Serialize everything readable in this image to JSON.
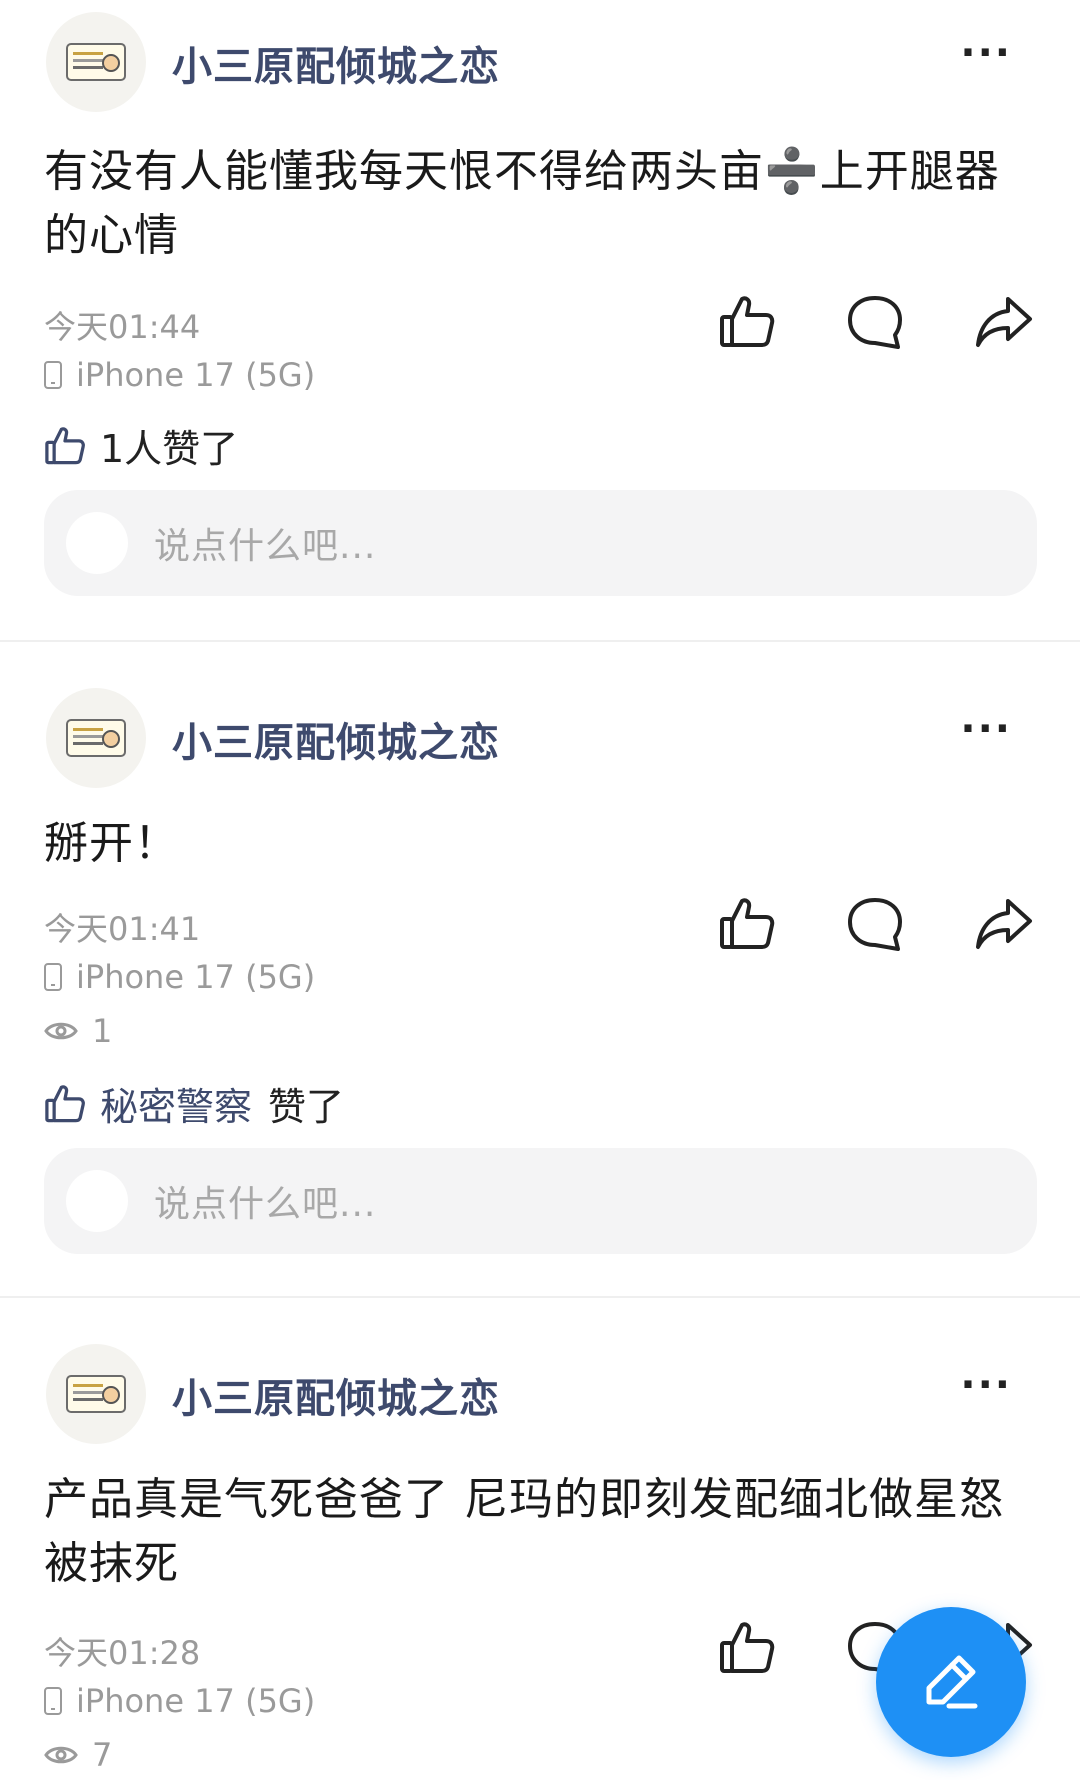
{
  "posts": [
    {
      "username": "小三原配倾城之恋",
      "more": "···",
      "content": "有没有人能懂我每天恨不得给两头亩➗上开腿器的心情",
      "time": "今天01:44",
      "device": "iPhone 17 (5G)",
      "likes_liker": "",
      "likes_text": "1人赞了",
      "comment_placeholder": "说点什么吧..."
    },
    {
      "username": "小三原配倾城之恋",
      "more": "···",
      "content": "掰开！",
      "time": "今天01:41",
      "device": "iPhone 17 (5G)",
      "views": "1",
      "likes_liker": "秘密警察",
      "likes_text": "赞了",
      "comment_placeholder": "说点什么吧..."
    },
    {
      "username": "小三原配倾城之恋",
      "more": "···",
      "content": "产品真是气死爸爸了 尼玛的即刻发配缅北做星怒被抹死",
      "time": "今天01:28",
      "device": "iPhone 17 (5G)",
      "views": "7"
    }
  ],
  "icons": {
    "like": "thumbs-up-icon",
    "comment": "comment-bubble-icon",
    "share": "share-arrow-icon",
    "views": "eye-icon",
    "device": "phone-icon",
    "compose": "pencil-icon"
  },
  "colors": {
    "username": "#3e4a6d",
    "secondary_text": "#9a9a9a",
    "comment_box": "#f4f4f5",
    "fab": "#1e90f5"
  }
}
